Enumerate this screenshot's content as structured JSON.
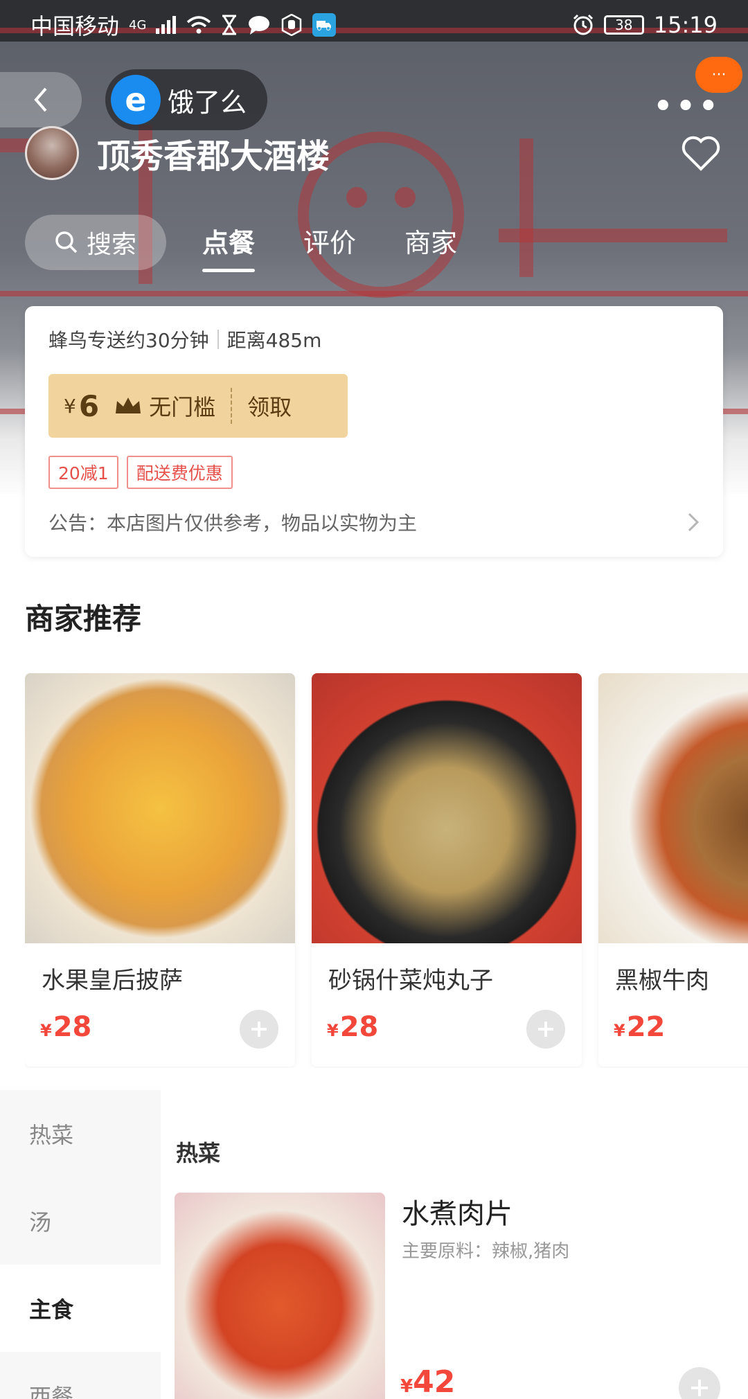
{
  "status_bar": {
    "carrier": "中国移动",
    "network": "4G",
    "time": "15:19",
    "battery": "38",
    "icons": [
      "signal-icon",
      "wifi-icon",
      "hourglass-icon",
      "message-icon",
      "hand-icon",
      "truck-icon",
      "alarm-icon",
      "battery-icon"
    ]
  },
  "header": {
    "app_name": "饿了么",
    "app_logo_letter": "e",
    "store_name": "顶秀香郡大酒楼",
    "more_badge": "···",
    "more_label": "•••"
  },
  "tabs": {
    "search_label": "搜索",
    "items": [
      "点餐",
      "评价",
      "商家"
    ],
    "active_index": 0
  },
  "info_card": {
    "delivery_text": "蜂鸟专送约30分钟",
    "distance_text": "距离485m",
    "coupon": {
      "currency": "¥",
      "amount": "6",
      "condition": "无门槛",
      "action": "领取"
    },
    "tags": [
      "20减1",
      "配送费优惠"
    ],
    "notice": "公告：本店图片仅供参考，物品以实物为主"
  },
  "recommendation": {
    "title": "商家推荐",
    "items": [
      {
        "name": "水果皇后披萨",
        "currency": "¥",
        "price": "28"
      },
      {
        "name": "砂锅什菜炖丸子",
        "currency": "¥",
        "price": "28"
      },
      {
        "name": "黑椒牛肉",
        "currency": "¥",
        "price": "22"
      }
    ]
  },
  "menu": {
    "categories": [
      "热菜",
      "汤",
      "主食",
      "西餐"
    ],
    "active_category_index": 2,
    "section_title": "热菜",
    "dish": {
      "name": "水煮肉片",
      "desc": "主要原料：辣椒,猪肉",
      "currency": "¥",
      "price": "42"
    }
  },
  "colors": {
    "price": "#f2473a",
    "coupon_bg": "#f1d49d",
    "app_blue": "#1a8cf0",
    "badge_orange": "#ff6a10"
  }
}
